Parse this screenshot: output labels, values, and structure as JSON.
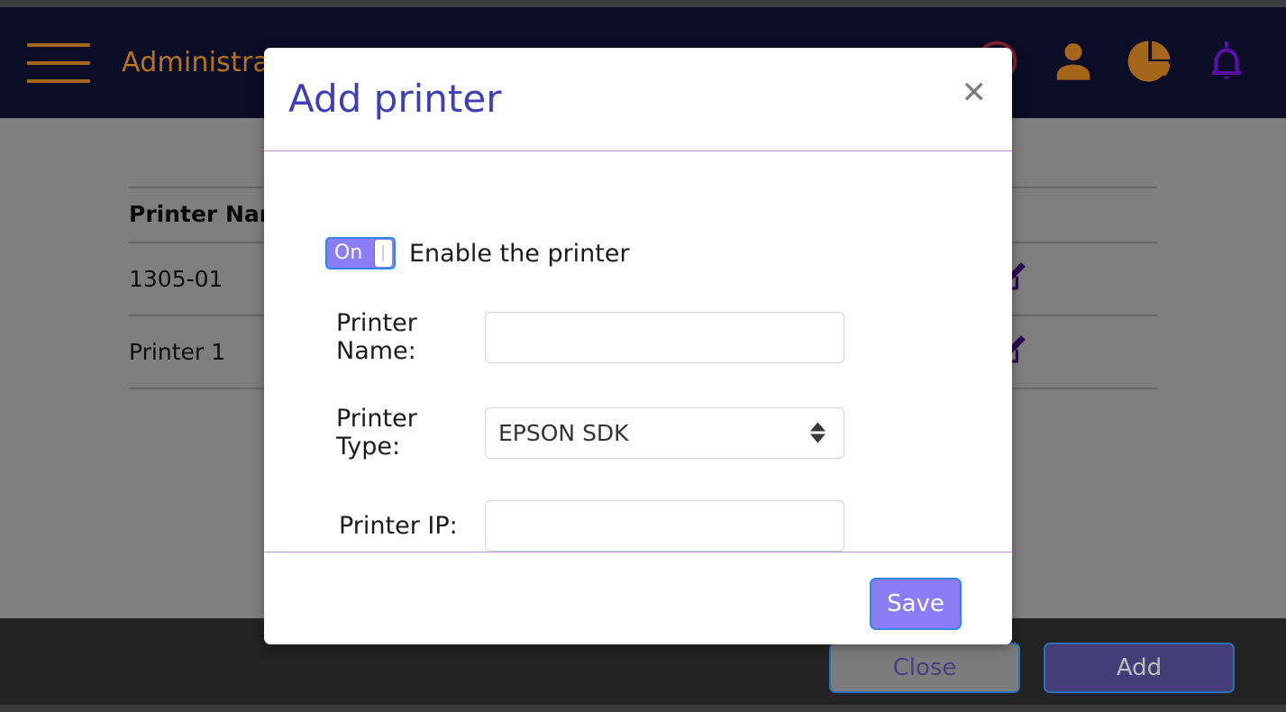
{
  "navbar": {
    "menu_icon": "hamburger-menu-icon",
    "title": "Administration",
    "icons": [
      {
        "name": "clock-icon",
        "color": "#7c2230"
      },
      {
        "name": "user-icon",
        "color": "#a5651a"
      },
      {
        "name": "pie-chart-icon",
        "color": "#a5651a"
      },
      {
        "name": "bell-icon",
        "color": "#5c0fa8"
      }
    ]
  },
  "printers_table": {
    "columns": [
      "Printer Name",
      ""
    ],
    "rows": [
      {
        "name": "1305-01",
        "action_icon": "edit-icon"
      },
      {
        "name": "Printer 1",
        "action_icon": "edit-icon"
      }
    ]
  },
  "bottom_bar": {
    "close_label": "Close",
    "add_label": "Add"
  },
  "modal": {
    "title": "Add printer",
    "close_icon": "✕",
    "toggle": {
      "state_label": "On",
      "description": "Enable the printer",
      "enabled": true
    },
    "fields": [
      {
        "label": "Printer Name:",
        "value": "",
        "placeholder": "",
        "type": "text"
      },
      {
        "label": "Printer Type:",
        "value": "EPSON SDK",
        "type": "select",
        "options": [
          "EPSON SDK"
        ]
      },
      {
        "label": "Printer IP:",
        "value": "",
        "placeholder": "",
        "type": "text"
      }
    ],
    "save_label": "Save"
  },
  "colors": {
    "navbar_bg": "#0b0c25",
    "nav_accent": "#b5741b",
    "modal_title": "#3f3fb5",
    "primary_purple": "#8c7df7",
    "focus_blue": "#2f87e8",
    "edit_icon": "#5c0fa8",
    "add_button": "#453d77",
    "close_button": "#7c7c7c"
  }
}
